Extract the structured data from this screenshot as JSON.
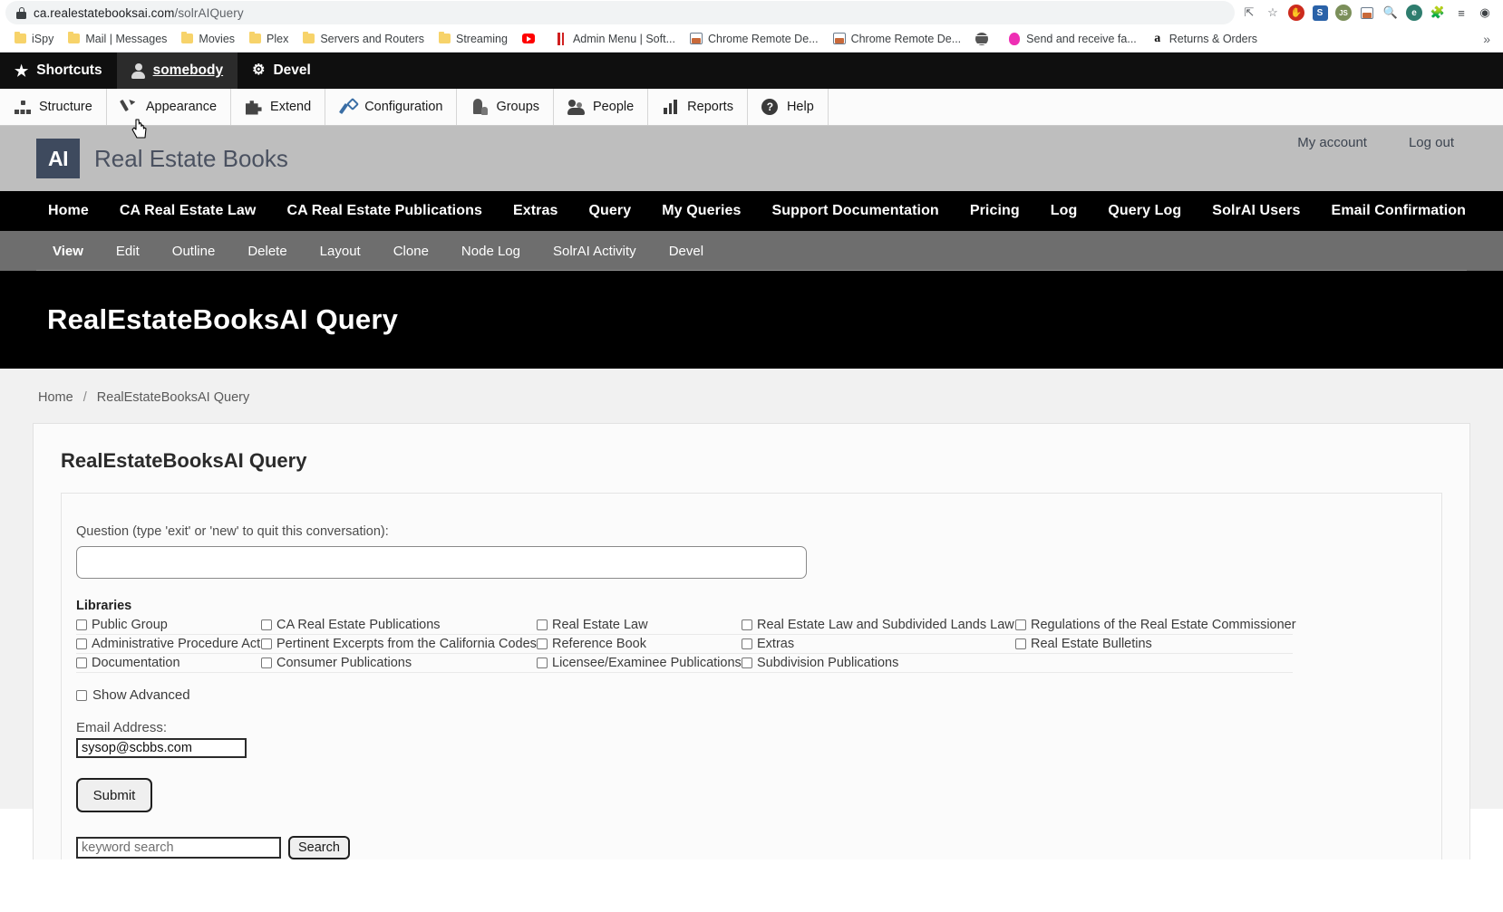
{
  "browser": {
    "url_host": "ca.realestatebooksai.com",
    "url_path": "/solrAIQuery",
    "lock_icon": "lock-icon",
    "actions": [
      {
        "name": "share-icon",
        "glyph": "↗"
      },
      {
        "name": "bookmark-star-icon",
        "glyph": "☆"
      },
      {
        "name": "extension-ublock-icon",
        "glyph": "✋"
      },
      {
        "name": "extension-s-icon",
        "glyph": "S"
      },
      {
        "name": "extension-js-icon",
        "glyph": "JS"
      },
      {
        "name": "extension-screenshot-icon",
        "glyph": "▣"
      },
      {
        "name": "extension-search-image-icon",
        "glyph": "🔍"
      },
      {
        "name": "extension-e-icon",
        "glyph": "e"
      },
      {
        "name": "extensions-puzzle-icon",
        "glyph": "🧩"
      },
      {
        "name": "extension-list-icon",
        "glyph": "≡"
      },
      {
        "name": "profile-avatar-icon",
        "glyph": "●"
      }
    ],
    "bookmarks": [
      {
        "label": "iSpy",
        "icon": "folder-icon"
      },
      {
        "label": "Mail | Messages",
        "icon": "folder-icon"
      },
      {
        "label": "Movies",
        "icon": "folder-icon"
      },
      {
        "label": "Plex",
        "icon": "folder-icon"
      },
      {
        "label": "Servers and Routers",
        "icon": "folder-icon"
      },
      {
        "label": "Streaming",
        "icon": "folder-icon"
      },
      {
        "label": "",
        "icon": "youtube-icon"
      },
      {
        "label": "Admin Menu | Soft...",
        "icon": "redbars-icon"
      },
      {
        "label": "Chrome Remote De...",
        "icon": "window-icon"
      },
      {
        "label": "Chrome Remote De...",
        "icon": "window-icon"
      },
      {
        "label": "",
        "icon": "globe-icon"
      },
      {
        "label": "Send and receive fa...",
        "icon": "pink-drop-icon"
      },
      {
        "label": "Returns & Orders",
        "icon": "amazon-icon"
      }
    ],
    "overflow_glyph": "»"
  },
  "admin_toolbar": {
    "tabs": [
      {
        "label": "Shortcuts",
        "icon": "star-icon",
        "active": false
      },
      {
        "label": "somebody",
        "icon": "person-icon",
        "active": true
      },
      {
        "label": "Devel",
        "icon": "gear-icon",
        "active": false
      }
    ]
  },
  "admin_menu": {
    "items": [
      {
        "label": "Structure",
        "icon": "structure-icon"
      },
      {
        "label": "Appearance",
        "icon": "paintbrush-icon"
      },
      {
        "label": "Extend",
        "icon": "puzzle-icon"
      },
      {
        "label": "Configuration",
        "icon": "wrench-icon"
      },
      {
        "label": "Groups",
        "icon": "groups-icon"
      },
      {
        "label": "People",
        "icon": "people-icon"
      },
      {
        "label": "Reports",
        "icon": "bar-chart-icon"
      },
      {
        "label": "Help",
        "icon": "question-circle-icon"
      }
    ]
  },
  "site_header": {
    "logo_text": "AI",
    "site_name": "Real Estate Books",
    "account_links": [
      "My account",
      "Log out"
    ]
  },
  "primary_nav": {
    "items": [
      "Home",
      "CA Real Estate Law",
      "CA Real Estate Publications",
      "Extras",
      "Query",
      "My Queries",
      "Support Documentation",
      "Pricing",
      "Log",
      "Query Log",
      "SolrAI Users",
      "Email Confirmation"
    ]
  },
  "secondary_tabs": {
    "items": [
      {
        "label": "View",
        "active": true
      },
      {
        "label": "Edit",
        "active": false
      },
      {
        "label": "Outline",
        "active": false
      },
      {
        "label": "Delete",
        "active": false
      },
      {
        "label": "Layout",
        "active": false
      },
      {
        "label": "Clone",
        "active": false
      },
      {
        "label": "Node Log",
        "active": false
      },
      {
        "label": "SolrAI Activity",
        "active": false
      },
      {
        "label": "Devel",
        "active": false
      }
    ]
  },
  "hero": {
    "title": "RealEstateBooksAI Query"
  },
  "breadcrumb": {
    "home": "Home",
    "separator": "/",
    "current": "RealEstateBooksAI Query"
  },
  "main": {
    "card_title": "RealEstateBooksAI Query",
    "question": {
      "label": "Question (type 'exit' or 'new' to quit this conversation):",
      "value": "",
      "placeholder": ""
    },
    "libraries": {
      "title": "Libraries",
      "rows": [
        [
          {
            "label": "Public Group",
            "checked": false
          },
          {
            "label": "CA Real Estate Publications",
            "checked": false
          },
          {
            "label": "Real Estate Law",
            "checked": false
          },
          {
            "label": "Real Estate Law and Subdivided Lands Law",
            "checked": false
          },
          {
            "label": "Regulations of the Real Estate Commissioner",
            "checked": false
          }
        ],
        [
          {
            "label": "Administrative Procedure Act",
            "checked": false
          },
          {
            "label": "Pertinent Excerpts from the California Codes",
            "checked": false
          },
          {
            "label": "Reference Book",
            "checked": false
          },
          {
            "label": "Extras",
            "checked": false
          },
          {
            "label": "Real Estate Bulletins",
            "checked": false
          }
        ],
        [
          {
            "label": "Documentation",
            "checked": false
          },
          {
            "label": "Consumer Publications",
            "checked": false
          },
          {
            "label": "Licensee/Examinee Publications",
            "checked": false
          },
          {
            "label": "Subdivision Publications",
            "checked": false
          }
        ]
      ]
    },
    "show_advanced": {
      "label": "Show Advanced",
      "checked": false
    },
    "email": {
      "label": "Email Address:",
      "value": "sysop@scbbs.com"
    },
    "submit": {
      "label": "Submit"
    },
    "keyword_search": {
      "placeholder": "keyword search",
      "value": "",
      "button_label": "Search"
    }
  },
  "colors": {
    "nav_black": "#000000",
    "header_gray": "#bebebe",
    "tabs_gray": "#6e6e6e",
    "logo_navy": "#3e4a5e",
    "page_bg": "#f1f1f1"
  }
}
